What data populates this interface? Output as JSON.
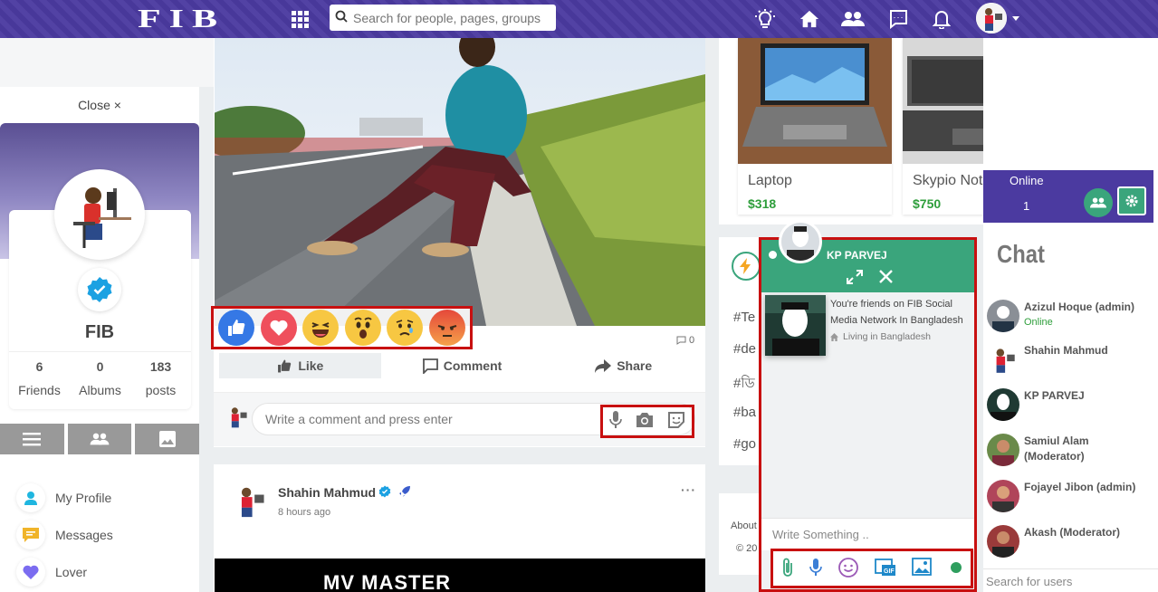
{
  "topbar": {
    "logo": "FIB",
    "search_placeholder": "Search for people, pages, groups and"
  },
  "left": {
    "close_label": "Close ×",
    "profile_name": "FIB",
    "stats": [
      {
        "value": "6",
        "label": "Friends"
      },
      {
        "value": "0",
        "label": "Albums"
      },
      {
        "value": "183",
        "label": "posts"
      }
    ],
    "menu": [
      {
        "label": "My Profile"
      },
      {
        "label": "Messages"
      },
      {
        "label": "Lover"
      }
    ]
  },
  "post": {
    "comment_count": "0",
    "actions": {
      "like": "Like",
      "comment": "Comment",
      "share": "Share"
    },
    "comment_placeholder": "Write a comment and press enter"
  },
  "post2": {
    "author": "Shahin Mahmud",
    "time": "8 hours ago",
    "banner_text": "MV MASTER"
  },
  "shop": {
    "products": [
      {
        "title": "Laptop",
        "price": "$318"
      },
      {
        "title": "Skypio Not",
        "price": "$750"
      }
    ]
  },
  "trending": {
    "tags": [
      "#Te",
      "#de",
      "#ডি",
      "#ba",
      "#go"
    ]
  },
  "about": {
    "line1": "About",
    "line2": "© 20"
  },
  "chat_window": {
    "name": "KP PARVEJ",
    "info_line1": "You're friends on FIB Social Media Network In Bangladesh",
    "info_line2": "Living in Bangladesh",
    "input_placeholder": "Write Something .."
  },
  "right": {
    "online_label": "Online",
    "online_count": "1",
    "chat_title": "Chat",
    "users": [
      {
        "name": "Azizul Hoque (admin)",
        "status": "Online"
      },
      {
        "name": "Shahin Mahmud",
        "status": ""
      },
      {
        "name": "KP PARVEJ",
        "status": ""
      },
      {
        "name": "Samiul Alam (Moderator)",
        "status": ""
      },
      {
        "name": "Fojayel Jibon (admin)",
        "status": ""
      },
      {
        "name": "Akash (Moderator)",
        "status": ""
      }
    ],
    "search_placeholder": "Search for users"
  },
  "colors": {
    "topbar": "#4b3aa0",
    "chat_header": "#3aa57c",
    "highlight_border": "#c81010",
    "price_green": "#2e9e3b"
  }
}
